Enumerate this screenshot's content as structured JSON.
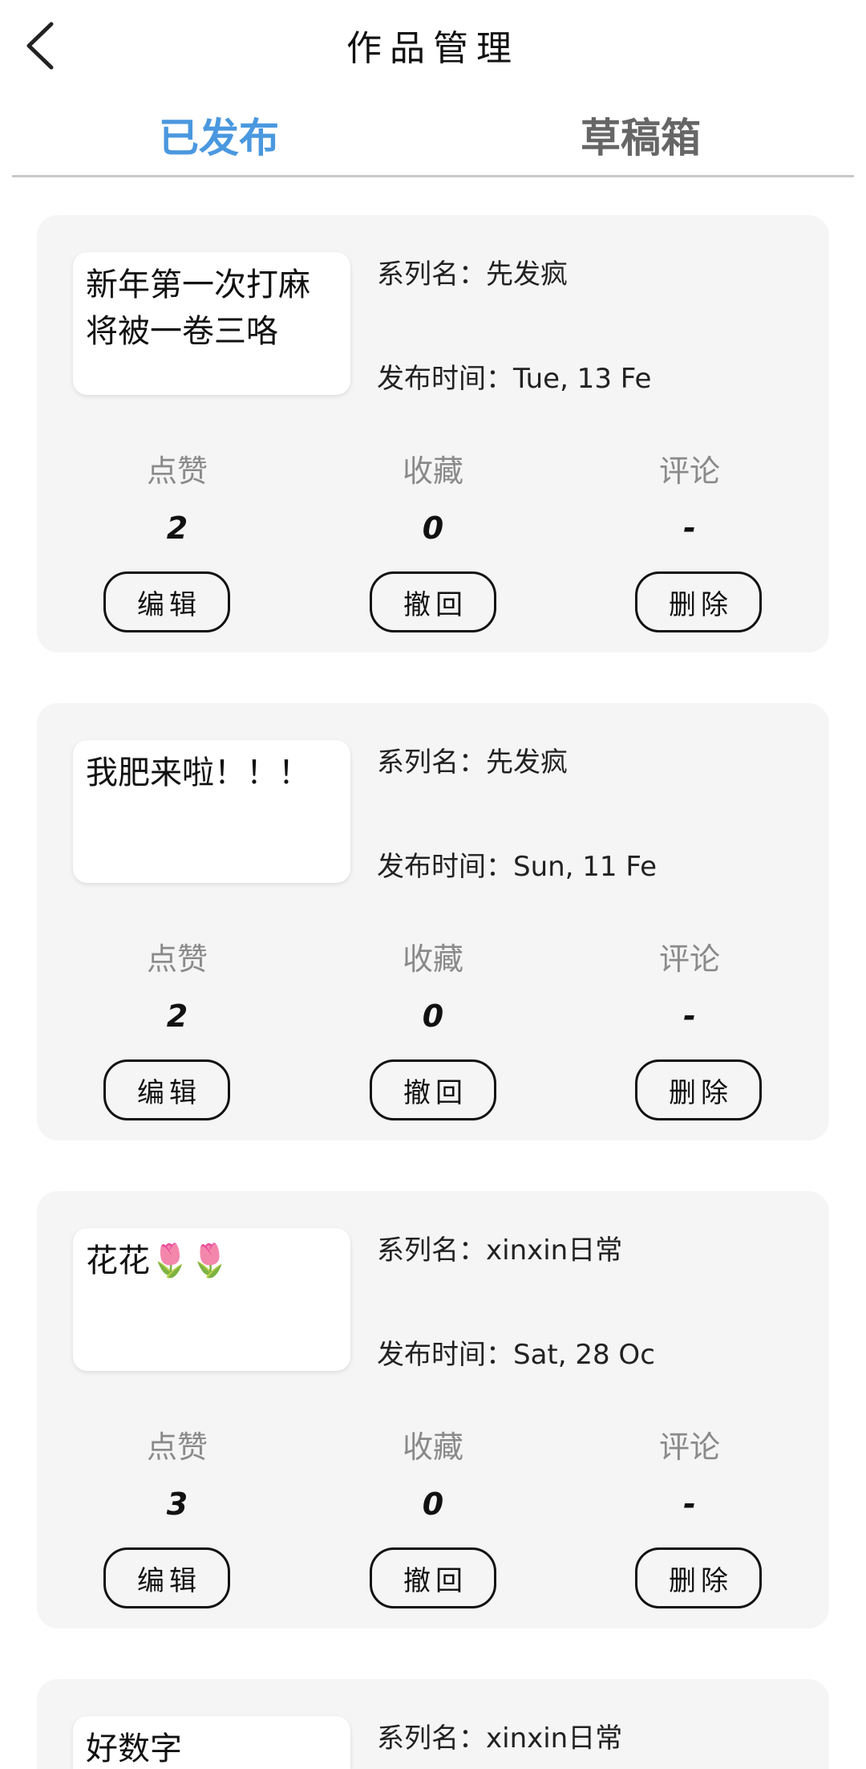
{
  "header": {
    "title": "作品管理",
    "back_icon": "chevron-left-icon"
  },
  "tabs": [
    {
      "label": "已发布",
      "active": true,
      "color": "#4a98df"
    },
    {
      "label": "草稿箱",
      "active": false,
      "color": "#666666"
    }
  ],
  "stat_labels": {
    "likes": "点赞",
    "favorites": "收藏",
    "comments": "评论"
  },
  "buttons": {
    "edit": "编辑",
    "withdraw": "撤回",
    "delete": "删除"
  },
  "posts": [
    {
      "title": "新年第一次打麻将被一卷三咯",
      "series": "系列名：先发疯",
      "publish_time": "发布时间：Tue, 13 Fe",
      "likes": "2",
      "favorites": "0",
      "comments": "-"
    },
    {
      "title": "我肥来啦！！！",
      "series": "系列名：先发疯",
      "publish_time": "发布时间：Sun, 11 Fe",
      "likes": "2",
      "favorites": "0",
      "comments": "-"
    },
    {
      "title": "花花🌷🌷",
      "series": "系列名：xinxin日常",
      "publish_time": "发布时间：Sat, 28 Oc",
      "likes": "3",
      "favorites": "0",
      "comments": "-"
    },
    {
      "title": "好数字",
      "series": "系列名：xinxin日常",
      "publish_time": "",
      "likes": "",
      "favorites": "",
      "comments": ""
    }
  ]
}
